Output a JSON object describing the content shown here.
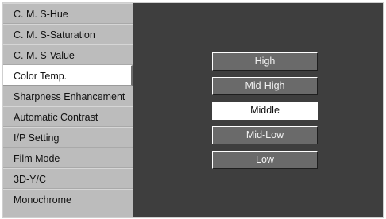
{
  "menu": {
    "items": [
      {
        "label": "C. M. S-Hue",
        "selected": false
      },
      {
        "label": "C. M. S-Saturation",
        "selected": false
      },
      {
        "label": "C. M. S-Value",
        "selected": false
      },
      {
        "label": "Color Temp.",
        "selected": true
      },
      {
        "label": "Sharpness Enhancement",
        "selected": false
      },
      {
        "label": "Automatic Contrast",
        "selected": false
      },
      {
        "label": "I/P Setting",
        "selected": false
      },
      {
        "label": "Film Mode",
        "selected": false
      },
      {
        "label": "3D-Y/C",
        "selected": false
      },
      {
        "label": "Monochrome",
        "selected": false
      }
    ]
  },
  "options": {
    "items": [
      {
        "label": "High",
        "selected": false
      },
      {
        "label": "Mid-High",
        "selected": false
      },
      {
        "label": "Middle",
        "selected": true
      },
      {
        "label": "Mid-Low",
        "selected": false
      },
      {
        "label": "Low",
        "selected": false
      }
    ]
  },
  "colors": {
    "panel_background": "#3e3e3e",
    "sidebar_background": "#bcbcbc",
    "option_background": "#6a6a6a",
    "selected_background": "#ffffff"
  }
}
